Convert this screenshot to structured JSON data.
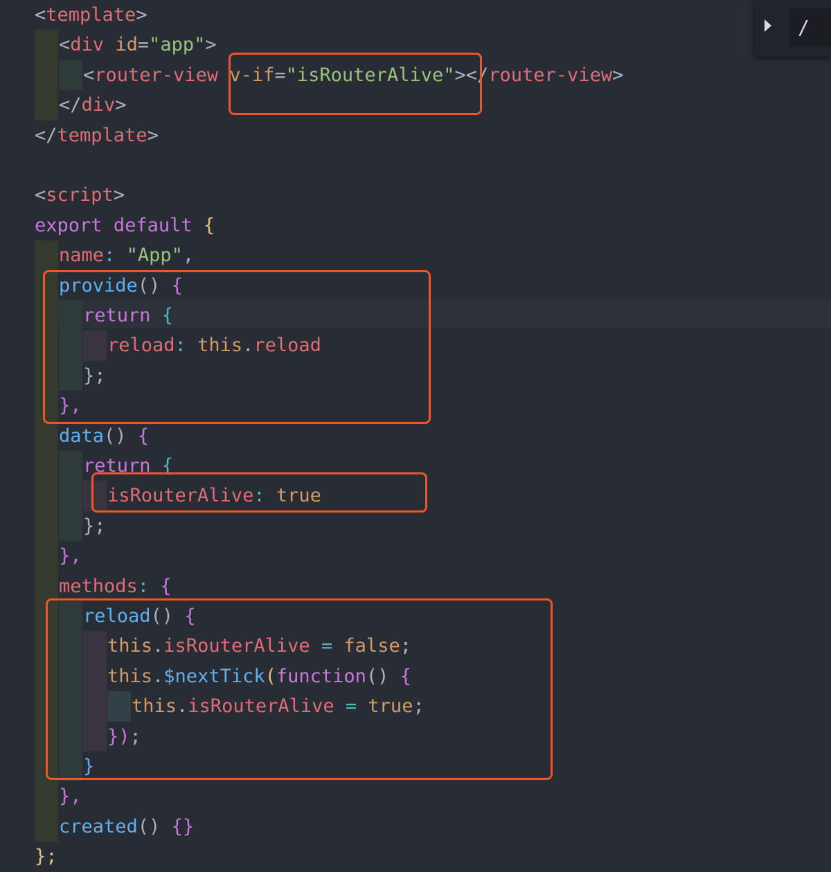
{
  "editor": {
    "colors": {
      "background": "#282c34",
      "tag": "#e06c75",
      "punct": "#abb2bf",
      "attr": "#d19a66",
      "string": "#98c379",
      "keyword": "#c678dd",
      "function": "#61afef",
      "cyan": "#56b6c2",
      "highlight_box": "#f0542a"
    },
    "lines": [
      [
        [
          "<",
          "p"
        ],
        [
          "template",
          "t"
        ],
        [
          ">",
          "p"
        ]
      ],
      [
        [
          "<",
          "p"
        ],
        [
          "div",
          "t"
        ],
        [
          " ",
          ""
        ],
        [
          "id",
          "a"
        ],
        [
          "=",
          "p"
        ],
        [
          "\"app\"",
          "s"
        ],
        [
          ">",
          "p"
        ]
      ],
      [
        [
          "<",
          "p"
        ],
        [
          "router-view",
          "t"
        ],
        [
          " ",
          ""
        ],
        [
          "v-if",
          "a"
        ],
        [
          "=",
          "p"
        ],
        [
          "\"isRouterAlive\"",
          "s"
        ],
        [
          "></",
          "p"
        ],
        [
          "router-view",
          "t"
        ],
        [
          ">",
          "p"
        ]
      ],
      [
        [
          "</",
          "p"
        ],
        [
          "div",
          "t"
        ],
        [
          ">",
          "p"
        ]
      ],
      [
        [
          "</",
          "p"
        ],
        [
          "template",
          "t"
        ],
        [
          ">",
          "p"
        ]
      ],
      [],
      [
        [
          "<",
          "p"
        ],
        [
          "script",
          "t"
        ],
        [
          ">",
          "p"
        ]
      ],
      [
        [
          "export",
          "k"
        ],
        [
          " ",
          ""
        ],
        [
          "default",
          "k"
        ],
        [
          " ",
          ""
        ],
        [
          "{",
          "y"
        ]
      ],
      [
        [
          "name",
          "t"
        ],
        [
          ":",
          "c"
        ],
        [
          " ",
          ""
        ],
        [
          "\"App\"",
          "s"
        ],
        [
          ",",
          "p"
        ]
      ],
      [
        [
          "provide",
          "f"
        ],
        [
          "()",
          "p"
        ],
        [
          " ",
          ""
        ],
        [
          "{",
          "k"
        ]
      ],
      [
        [
          "return",
          "k"
        ],
        [
          " ",
          ""
        ],
        [
          "{",
          "c"
        ]
      ],
      [
        [
          "reload",
          "t"
        ],
        [
          ":",
          "c"
        ],
        [
          " ",
          ""
        ],
        [
          "this",
          "o"
        ],
        [
          ".",
          "p"
        ],
        [
          "reload",
          "t"
        ]
      ],
      [
        [
          "};",
          "p"
        ]
      ],
      [
        [
          "},",
          "k"
        ]
      ],
      [
        [
          "data",
          "f"
        ],
        [
          "()",
          "p"
        ],
        [
          " ",
          ""
        ],
        [
          "{",
          "k"
        ]
      ],
      [
        [
          "return",
          "k"
        ],
        [
          " ",
          ""
        ],
        [
          "{",
          "c"
        ]
      ],
      [
        [
          "isRouterAlive",
          "t"
        ],
        [
          ":",
          "c"
        ],
        [
          " ",
          ""
        ],
        [
          "true",
          "o"
        ]
      ],
      [
        [
          "};",
          "p"
        ]
      ],
      [
        [
          "},",
          "k"
        ]
      ],
      [
        [
          "methods",
          "t"
        ],
        [
          ":",
          "c"
        ],
        [
          " ",
          ""
        ],
        [
          "{",
          "k"
        ]
      ],
      [
        [
          "reload",
          "f"
        ],
        [
          "()",
          "p"
        ],
        [
          " ",
          ""
        ],
        [
          "{",
          "k"
        ]
      ],
      [
        [
          "this",
          "o"
        ],
        [
          ".",
          "p"
        ],
        [
          "isRouterAlive",
          "t"
        ],
        [
          " ",
          ""
        ],
        [
          "=",
          "c"
        ],
        [
          " ",
          ""
        ],
        [
          "false",
          "o"
        ],
        [
          ";",
          "p"
        ]
      ],
      [
        [
          "this",
          "o"
        ],
        [
          ".",
          "p"
        ],
        [
          "$nextTick",
          "f"
        ],
        [
          "(",
          "y"
        ],
        [
          "function",
          "k"
        ],
        [
          "()",
          "p"
        ],
        [
          " ",
          ""
        ],
        [
          "{",
          "k"
        ]
      ],
      [
        [
          "this",
          "o"
        ],
        [
          ".",
          "p"
        ],
        [
          "isRouterAlive",
          "t"
        ],
        [
          " ",
          ""
        ],
        [
          "=",
          "c"
        ],
        [
          " ",
          ""
        ],
        [
          "true",
          "o"
        ],
        [
          ";",
          "p"
        ]
      ],
      [
        [
          "})",
          "k"
        ],
        [
          ";",
          "p"
        ]
      ],
      [
        [
          "}",
          "f"
        ]
      ],
      [
        [
          "},",
          "k"
        ]
      ],
      [
        [
          "created",
          "f"
        ],
        [
          "()",
          "p"
        ],
        [
          " ",
          ""
        ],
        [
          "{}",
          "k"
        ]
      ],
      [
        [
          "};",
          "y"
        ]
      ]
    ],
    "indents": [
      0,
      1,
      2,
      1,
      0,
      0,
      0,
      0,
      1,
      1,
      2,
      3,
      2,
      1,
      1,
      2,
      3,
      2,
      1,
      1,
      2,
      3,
      3,
      4,
      3,
      2,
      1,
      1,
      0
    ]
  },
  "find_widget": {
    "toggle_icon": "chevron-right-icon",
    "query": "/"
  }
}
